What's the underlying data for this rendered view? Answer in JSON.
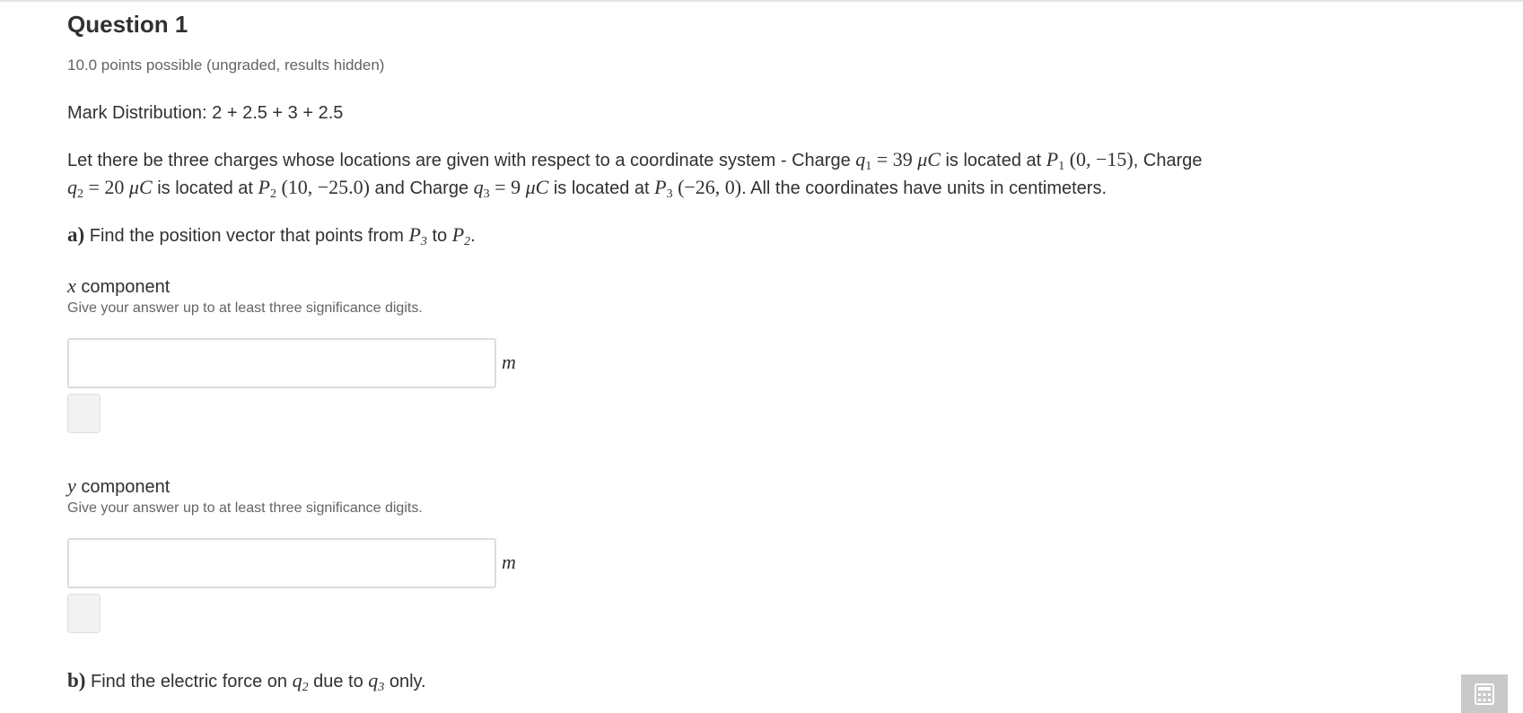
{
  "question": {
    "title": "Question 1",
    "points": "10.0 points possible (ungraded, results hidden)",
    "mark_distribution": "Mark Distribution: 2 + 2.5 + 3 + 2.5"
  },
  "problem": {
    "t1": "Let there be three charges whose locations are given with respect to a coordinate system - Charge ",
    "q1_val": "39",
    "mu_c": "μC",
    "t_located": " is located at ",
    "p1_coords": "(0, −15)",
    "t_charge": ", Charge",
    "q2_val": "20",
    "p2_coords": "(10, −25.0)",
    "t_and_charge": " and Charge ",
    "q3_val": "9",
    "p3_coords": "(−26, 0)",
    "t_end": ". All the coordinates have units in centimeters."
  },
  "part_a": {
    "label": "a)",
    "text_before": " Find the position vector that points from ",
    "text_to": " to ",
    "text_end": ".",
    "x_component": {
      "var": "x",
      "label": " component",
      "hint": "Give your answer up to at least three significance digits.",
      "value": "",
      "unit": "m"
    },
    "y_component": {
      "var": "y",
      "label": " component",
      "hint": "Give your answer up to at least three significance digits.",
      "value": "",
      "unit": "m"
    }
  },
  "part_b": {
    "label": "b)",
    "text_before": " Find the electric force on ",
    "text_mid": " due to ",
    "text_end": " only."
  },
  "symbols": {
    "q": "q",
    "p": "P",
    "eq": " = ",
    "n1": "1",
    "n2": "2",
    "n3": "3"
  },
  "colors": {
    "text": "#313131",
    "muted": "#646464",
    "input_border": "#dcdcdc",
    "calculator_bg": "#c9c9c9"
  },
  "icons": {
    "calculator": "calculator-icon"
  }
}
